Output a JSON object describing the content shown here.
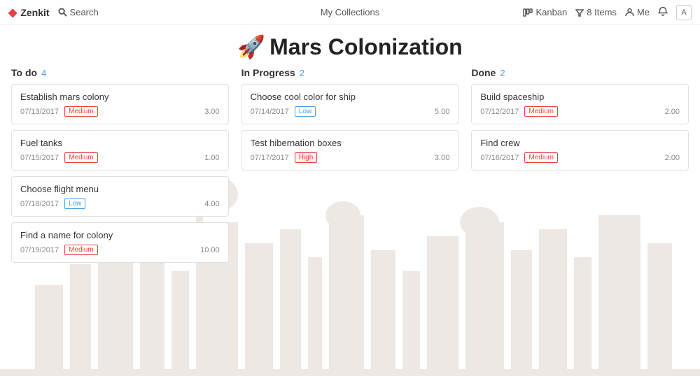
{
  "app": {
    "name": "Zenkit",
    "logo_diamond": "◆"
  },
  "nav": {
    "search_label": "Search",
    "collections_label": "My Collections",
    "kanban_label": "Kanban",
    "items_label": "8 Items",
    "me_label": "Me",
    "avatar_label": "A"
  },
  "page": {
    "title": "Mars Colonization",
    "rocket": "🚀"
  },
  "columns": [
    {
      "id": "todo",
      "title": "To do",
      "count": "4",
      "cards": [
        {
          "title": "Establish mars colony",
          "date": "07/13/2017",
          "badge": "Medium",
          "badge_type": "medium",
          "points": "3.00"
        },
        {
          "title": "Fuel tanks",
          "date": "07/15/2017",
          "badge": "Medium",
          "badge_type": "medium",
          "points": "1.00"
        },
        {
          "title": "Choose flight menu",
          "date": "07/18/2017",
          "badge": "Low",
          "badge_type": "low",
          "points": "4.00"
        },
        {
          "title": "Find a name for colony",
          "date": "07/19/2017",
          "badge": "Medium",
          "badge_type": "medium",
          "points": "10.00"
        }
      ]
    },
    {
      "id": "inprogress",
      "title": "In Progress",
      "count": "2",
      "cards": [
        {
          "title": "Choose cool color for ship",
          "date": "07/14/2017",
          "badge": "Low",
          "badge_type": "low",
          "points": "5.00"
        },
        {
          "title": "Test hibernation boxes",
          "date": "07/17/2017",
          "badge": "High",
          "badge_type": "high",
          "points": "3.00"
        }
      ]
    },
    {
      "id": "done",
      "title": "Done",
      "count": "2",
      "cards": [
        {
          "title": "Build spaceship",
          "date": "07/12/2017",
          "badge": "Medium",
          "badge_type": "medium",
          "points": "2.00"
        },
        {
          "title": "Find crew",
          "date": "07/16/2017",
          "badge": "Medium",
          "badge_type": "medium",
          "points": "2.00"
        }
      ]
    }
  ]
}
